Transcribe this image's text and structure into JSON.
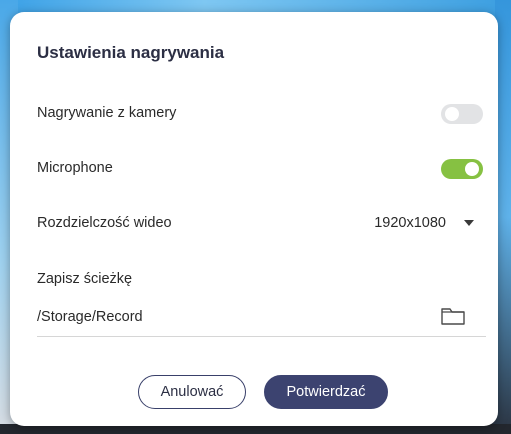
{
  "dialog": {
    "title": "Ustawienia nagrywania",
    "camera": {
      "label": "Nagrywanie z kamery",
      "enabled": false
    },
    "microphone": {
      "label": "Microphone",
      "enabled": true
    },
    "resolution": {
      "label": "Rozdzielczość wideo",
      "value": "1920x1080"
    },
    "save_path": {
      "label": "Zapisz ścieżkę",
      "value": "/Storage/Record"
    },
    "buttons": {
      "cancel": "Anulować",
      "confirm": "Potwierdzać"
    }
  },
  "icons": {
    "resolution_dropdown": "triangle-down-icon",
    "save_path_browse": "folder-icon"
  },
  "colors": {
    "toggle_on": "#86c142",
    "toggle_off": "#e2e3e5",
    "primary_button": "#3c4370",
    "title_text": "#2c2f44"
  }
}
